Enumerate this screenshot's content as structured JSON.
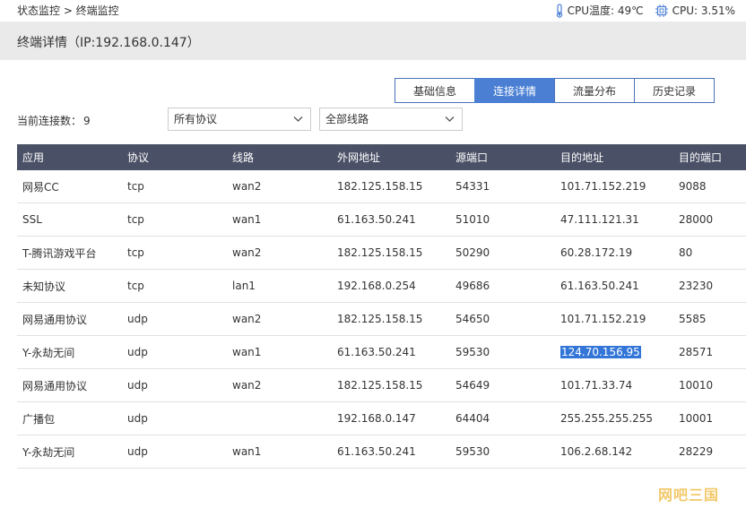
{
  "breadcrumb": {
    "text": "状态监控 > 终端监控"
  },
  "cpu": {
    "temp_label": "CPU温度: 49℃",
    "usage_label": "CPU: 3.51%"
  },
  "page": {
    "title": "终端详情（IP:192.168.0.147）"
  },
  "tabs": [
    {
      "label": "基础信息",
      "active": false
    },
    {
      "label": "连接详情",
      "active": true
    },
    {
      "label": "流量分布",
      "active": false
    },
    {
      "label": "历史记录",
      "active": false
    }
  ],
  "filters": {
    "conn_label": "当前连接数：",
    "conn_count": "9",
    "protocol_selected": "所有协议",
    "line_selected": "全部线路"
  },
  "table": {
    "headers": [
      "应用",
      "协议",
      "线路",
      "外网地址",
      "源端口",
      "目的地址",
      "目的端口"
    ],
    "rows": [
      [
        "网易CC",
        "tcp",
        "wan2",
        "182.125.158.15",
        "54331",
        "101.71.152.219",
        "9088"
      ],
      [
        "SSL",
        "tcp",
        "wan1",
        "61.163.50.241",
        "51010",
        "47.111.121.31",
        "28000"
      ],
      [
        "T-腾讯游戏平台",
        "tcp",
        "wan2",
        "182.125.158.15",
        "50290",
        "60.28.172.19",
        "80"
      ],
      [
        "未知协议",
        "tcp",
        "lan1",
        "192.168.0.254",
        "49686",
        "61.163.50.241",
        "23230"
      ],
      [
        "网易通用协议",
        "udp",
        "wan2",
        "182.125.158.15",
        "54650",
        "101.71.152.219",
        "5585"
      ],
      [
        "Y-永劫无间",
        "udp",
        "wan1",
        "61.163.50.241",
        "59530",
        "124.70.156.95",
        "28571"
      ],
      [
        "网易通用协议",
        "udp",
        "wan2",
        "182.125.158.15",
        "54649",
        "101.71.33.74",
        "10010"
      ],
      [
        "广播包",
        "udp",
        "",
        "192.168.0.147",
        "64404",
        "255.255.255.255",
        "10001"
      ],
      [
        "Y-永劫无间",
        "udp",
        "wan1",
        "61.163.50.241",
        "59530",
        "106.2.68.142",
        "28229"
      ]
    ]
  },
  "watermark": {
    "text": "网吧三国"
  },
  "colors": {
    "accent": "#4a7fd4",
    "header_bg": "#4a5166",
    "title_bar_bg": "#eaeaea",
    "selection": "#3376d8"
  },
  "icons": {
    "temp": "thermometer-icon",
    "cpu": "cpu-chip-icon",
    "dropdown": "chevron-down-icon"
  }
}
